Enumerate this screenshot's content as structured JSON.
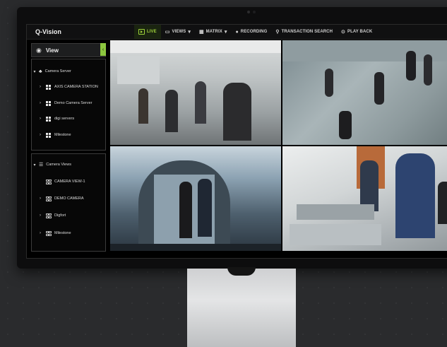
{
  "app": {
    "title": "Q-Vision"
  },
  "nav": [
    {
      "label": "LIVE",
      "icon": "live-icon",
      "active": true
    },
    {
      "label": "VIEWS",
      "icon": "views-icon",
      "dropdown": true
    },
    {
      "label": "MATRIX",
      "icon": "matrix-icon",
      "dropdown": true
    },
    {
      "label": "RECORDING",
      "icon": "record-icon"
    },
    {
      "label": "TRANSACTION SEARCH",
      "icon": "search-icon"
    },
    {
      "label": "PLAY BACK",
      "icon": "playback-icon"
    }
  ],
  "sidebar": {
    "header": "View",
    "camera_server": {
      "label": "Camera Server",
      "items": [
        "AXIS CAMERA STATION",
        "Demo Camera Server",
        "digi servers",
        "Milestone"
      ]
    },
    "camera_views": {
      "label": "Camera Views",
      "items": [
        "CAMERA VIEW-1",
        "DEMO CAMERA",
        "Digfort",
        "Milestone"
      ]
    }
  },
  "colors": {
    "accent": "#8cc63f",
    "background": "#2a2b2d",
    "screen": "#000000"
  }
}
